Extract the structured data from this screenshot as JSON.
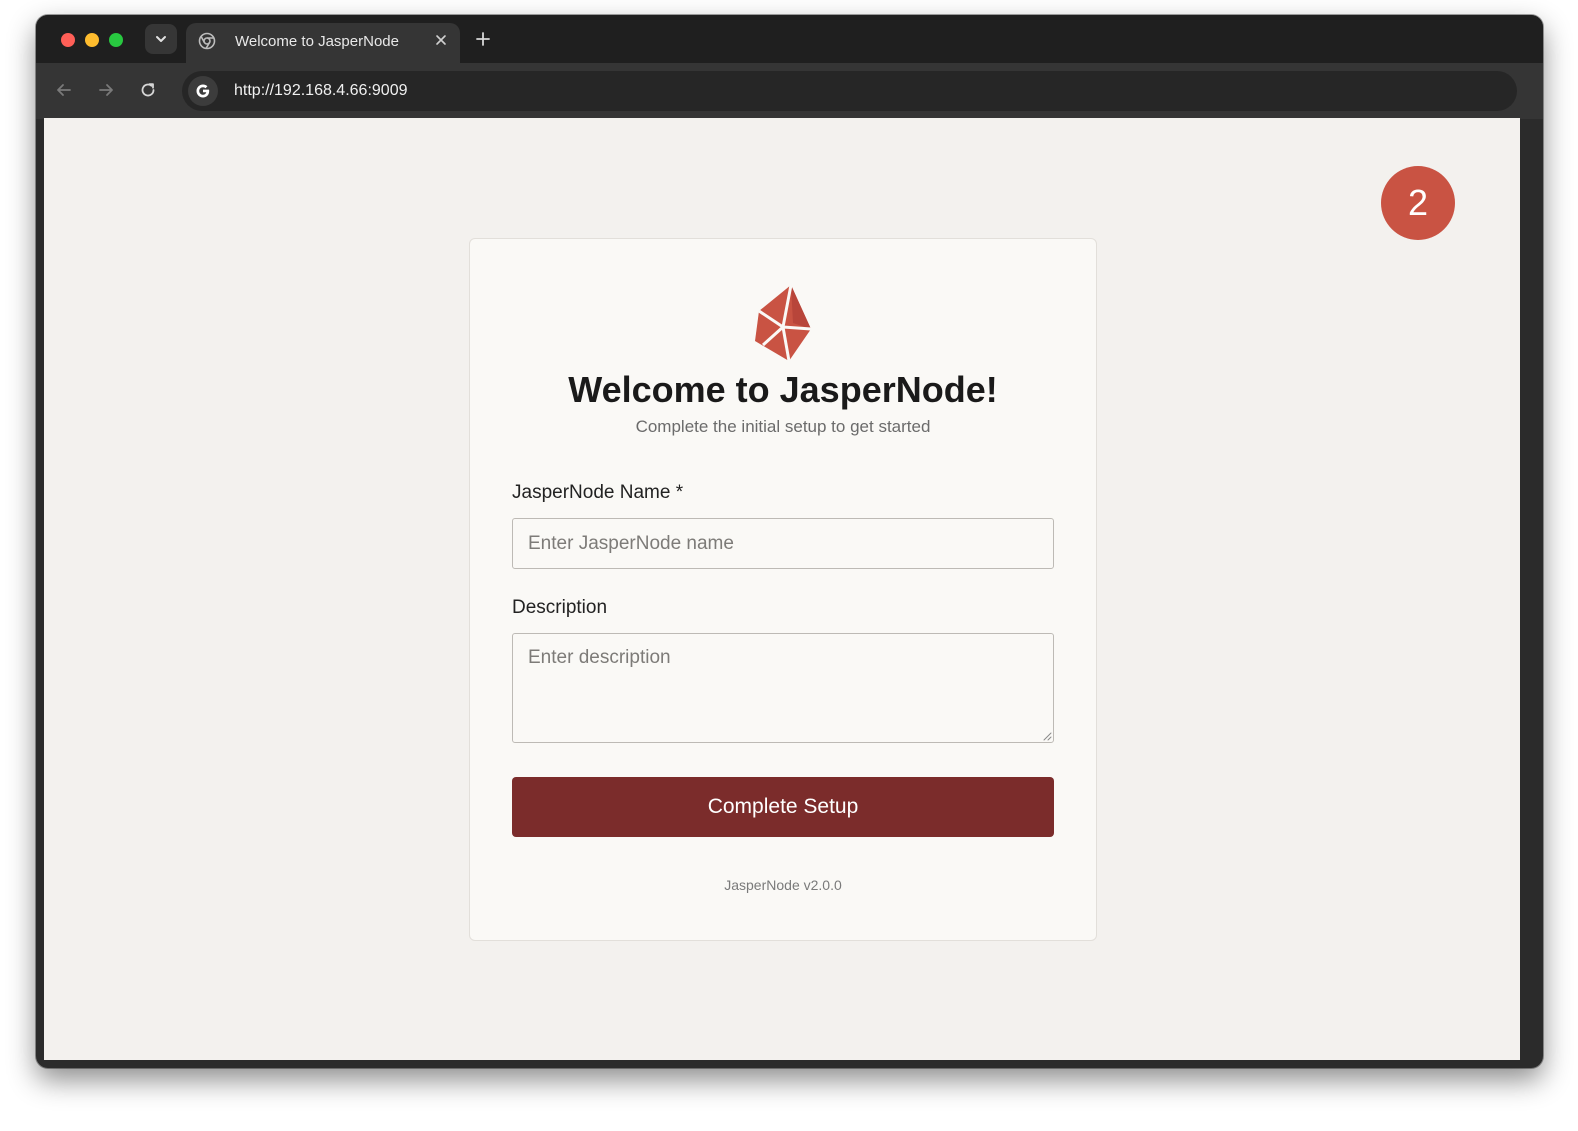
{
  "browser": {
    "tab_title": "Welcome to JasperNode",
    "url": "http://192.168.4.66:9009"
  },
  "step_badge": "2",
  "setup": {
    "title": "Welcome to JasperNode!",
    "subtitle": "Complete the initial setup to get started",
    "name_label": "JasperNode Name *",
    "name_placeholder": "Enter JasperNode name",
    "description_label": "Description",
    "description_placeholder": "Enter description",
    "submit_label": "Complete Setup",
    "version": "JasperNode v2.0.0"
  },
  "colors": {
    "brand": "#c95343",
    "button": "#7b2c2b",
    "page_background": "#f3f1ee"
  },
  "icons": {
    "logo": "jaspernode-logo",
    "tab_favicon": "chrome-icon",
    "site_info": "google-g-icon"
  }
}
